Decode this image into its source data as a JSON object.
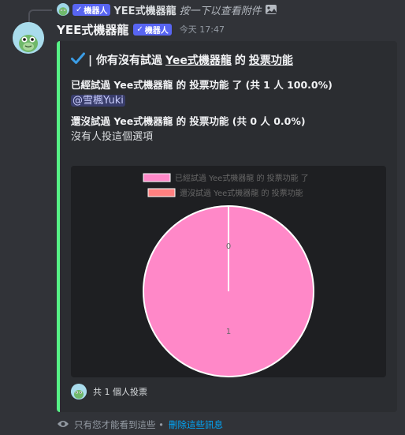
{
  "reply": {
    "name": "YEE式機器龍",
    "bot_tag": "機器人",
    "content": "按一下以查看附件"
  },
  "message": {
    "username": "YEE式機器龍",
    "bot_tag": "機器人",
    "timestamp": "今天 17:47"
  },
  "embed": {
    "accent_color": "#57f287",
    "title_prefix": "| 你有沒有試過",
    "title_subject": "Yee式機器龍",
    "title_middle": "的",
    "title_feature": "投票功能",
    "fields": [
      {
        "name": "已經試過 Yee式機器龍 的 投票功能 了 (共 1 人 100.0%)",
        "value": "@雪楓Yuki",
        "is_mention": true
      },
      {
        "name": "還沒試過 Yee式機器龍 的 投票功能 (共 0 人 0.0%)",
        "value": "沒有人投這個選項",
        "is_mention": false
      }
    ],
    "footer": "共 1 個人投票"
  },
  "chart_data": {
    "type": "pie",
    "categories": [
      "已經試過 Yee式機器龍 的 投票功能 了",
      "還沒試過 Yee式機器龍 的 投票功能"
    ],
    "values": [
      1,
      0
    ],
    "colors": [
      "#ff88c8",
      "#ff8080"
    ],
    "legend_position": "top"
  },
  "ephemeral": {
    "notice": "只有您才能看到這些 •",
    "link": "刪除這些訊息"
  }
}
